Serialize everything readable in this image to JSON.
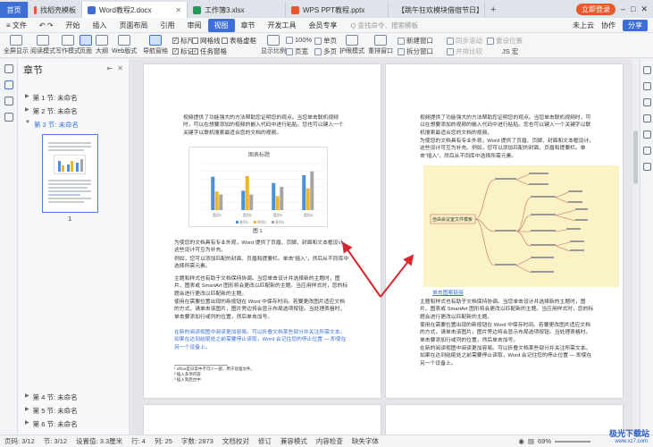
{
  "tabs": [
    {
      "label": "首页",
      "kind": "home"
    },
    {
      "label": "找稻壳模板",
      "icon_color": "#e8582b"
    },
    {
      "label": "Word教程2.docx",
      "icon_color": "#3d6fd6",
      "active": true
    },
    {
      "label": "工作簿3.xlsx",
      "icon_color": "#1f9d55"
    },
    {
      "label": "WPS PPT教程.pptx",
      "icon_color": "#e8582b"
    },
    {
      "label": "【跳午狂欢模块借宿节日】",
      "icon_color": "#e8582b"
    }
  ],
  "add_tab": "+",
  "login_button": "立即登录",
  "menu": {
    "file": "≡ 文件",
    "items": [
      "开始",
      "插入",
      "页面布局",
      "引用",
      "审阅",
      "视图",
      "章节",
      "开发工具",
      "会员专享"
    ],
    "active": "视图",
    "search_placeholder": "Q 查找命令、搜索模板",
    "unsaved": "未上云",
    "collab": "协作",
    "share": "分享"
  },
  "toolbar": {
    "big": [
      {
        "label": "全屏显示"
      },
      {
        "label": "阅读模式"
      },
      {
        "label": "写作模式"
      },
      {
        "label": "页面",
        "selected": true
      },
      {
        "label": "大纲"
      },
      {
        "label": "Web版式"
      },
      {
        "label": "导航窗格"
      }
    ],
    "checks": [
      {
        "label": "标尺",
        "checked": true
      },
      {
        "label": "网格线",
        "checked": false
      },
      {
        "label": "表格虚框",
        "checked": false
      },
      {
        "label": "标记",
        "checked": true
      },
      {
        "label": "任务窗格",
        "checked": true
      }
    ],
    "zoom": {
      "pct": "100%",
      "single": "单页",
      "show_ratio": "显示比例",
      "fullpage": "页宽",
      "multipage": "多页"
    },
    "eye": "护眼模式",
    "rearrange": "重排窗口",
    "new_window": "新建窗口",
    "split": "拆分窗口",
    "sync_scroll": "同步滚动",
    "side_by_side": "并排比较",
    "reset_pos": "重设位置",
    "js": "JS 宏"
  },
  "nav": {
    "title": "章节",
    "items_top": [
      {
        "label": "第 1 节: 未命名",
        "active": false
      },
      {
        "label": "第 2 节: 未命名",
        "active": false
      },
      {
        "label": "第 3 节: 未命名",
        "active": true
      }
    ],
    "thumb_page": "1",
    "items_bottom": [
      {
        "label": "第 4 节: 未命名"
      },
      {
        "label": "第 5 节: 未命名"
      },
      {
        "label": "第 6 节: 未命名"
      }
    ]
  },
  "page1": {
    "para1": "视频提供了功能强大的方法帮助您证明您的观点。当您单击联机视频时，可以在想要添加的视频的嵌入代码中进行粘贴。您也可以键入一个关键字以联机搜索最适合您的文档的视频。",
    "chart_caption": "图 1",
    "para2": "为使您的文档具有专业外观，Word 提供了页眉、页脚、封面和文本框设计，这些设计可互为补充。",
    "para3": "例如，您可以添加匹配的封面、页眉和提要栏。单击“插入”，然后从不同库中选择所需元素。",
    "para4": "主题和样式也有助于文档保持协调。当您单击设计并选择新的主题时，图片、图表或 SmartArt 图形将会更改以匹配新的主题。当应用样式时，您的标题会进行更改以匹配新的主题。",
    "para5": "使用在需要位置出现的新按钮在 Word 中保存时间。若要更改图片适应文档的方式，请单击该图片，图片旁边将会显示布局选项按钮。当处理表格时，单击要添加行或列的位置，然后单击加号。",
    "para6": "在新的阅读视图中阅读更加容易。可以折叠文档某些部分并关注所需文本。如果在达到结尾处之前需要停止读取，Word 会记住您的停止位置 — 即使在另一个设备上。",
    "footnote1": "¹ office是日常中不可少一部，用于处理文件。",
    "footnote2": "² 插入多项内容",
    "footnote3": "³ 插入到后台中"
  },
  "page2": {
    "para1": "视频提供了功能强大的方法帮助您证明您的观点。当您单击联机视频时，可以在想要添加的视频的嵌入代码中进行粘贴。您也可以键入一个关键字以联机搜索最适合您的文档的视频。",
    "para2": "为使您的文档具有专业外观，Word 提供了页眉、页脚、封面和文本框设计，这些设计可互为补充。例如，您可以添加匹配的封面、页眉和提要栏。单击“插入”，然后从不同库中选择所需元素。",
    "mindmap_root": "自由会议室文件模板",
    "link": "单击图案链接",
    "para3": "主题和样式也有助于文档保持协调。当您单击设计并选择新的主题时，图片、图表或 SmartArt 图形将会更改以匹配新的主题。当应用样式时，您的标题会进行更改以匹配新的主题。",
    "para4": "使用在需要位置出现的新按钮在 Word 中保存时间。若要更改图片适应文档的方式，请单击该图片，图片旁边将会显示布局选项按钮。当处理表格时，单击要添加行或列的位置，然后单击加号。",
    "para5": "在新的阅读视图中阅读更加容易。可以折叠文档某些部分并关注所需文本。如果在达到结尾处之前需要停止读取，Word 会记住您的停止位置 — 即使在另一个设备上。"
  },
  "chart_data": {
    "type": "bar",
    "title": "图表标题",
    "categories": [
      "类别1",
      "类别2",
      "类别3",
      "类别4"
    ],
    "series": [
      {
        "name": "系列1",
        "color": "#4a90d9",
        "values": [
          4.3,
          2.5,
          3.5,
          4.5
        ]
      },
      {
        "name": "系列2",
        "color": "#f0b429",
        "values": [
          2.4,
          4.4,
          1.8,
          2.8
        ]
      },
      {
        "name": "系列3",
        "color": "#a5a5a5",
        "values": [
          2.0,
          2.0,
          3.0,
          5.0
        ]
      }
    ],
    "legend": "bottom",
    "ylim": [
      0,
      6
    ]
  },
  "status": {
    "page": "页码: 3/12",
    "section": "节: 3/12",
    "setting": "设置值: 3.3厘米",
    "row": "行: 4",
    "col": "列: 25",
    "words": "字数: 2873",
    "spell": "文档校对",
    "modify": "修订",
    "compat": "兼容模式",
    "content": "内容检查",
    "missing_font": "缺失字体",
    "zoom": "69%"
  },
  "watermark": "极光下载站",
  "watermark_url": "www.xz7.com"
}
